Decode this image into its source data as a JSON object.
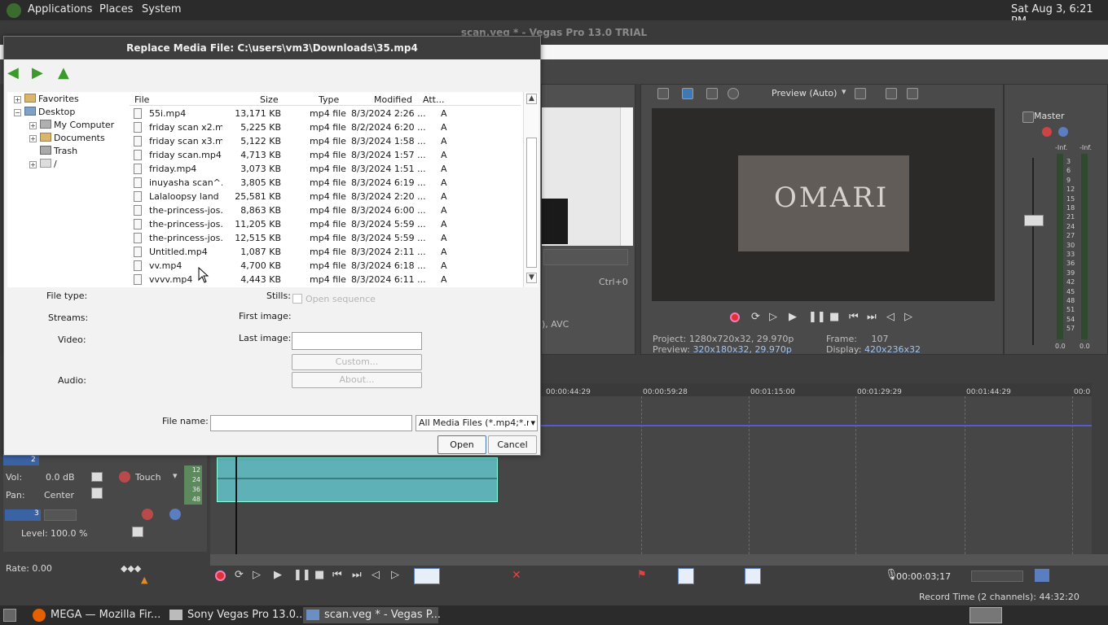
{
  "topbar": {
    "applications": "Applications",
    "places": "Places",
    "system": "System",
    "clock": "Sat Aug  3,  6:21 PM"
  },
  "vegas": {
    "window_title": "scan.veg * - Vegas Pro 13.0 TRIAL",
    "preview_mode": "Preview (Auto)",
    "shortcut": "Ctrl+0",
    "codec_partial": "), AVC",
    "project_label": "Project:",
    "project_value": "1280x720x32, 29.970p",
    "preview_label": "Preview:",
    "preview_value": "320x180x32, 29.970p",
    "frame_label": "Frame:",
    "frame_value": "107",
    "display_label": "Display:",
    "display_value": "420x236x32",
    "master_label": "Master",
    "meter_top": [
      "-Inf.",
      "-Inf."
    ],
    "meter_scale": [
      "3",
      "6",
      "9",
      "12",
      "15",
      "18",
      "21",
      "24",
      "27",
      "30",
      "33",
      "36",
      "39",
      "42",
      "45",
      "48",
      "51",
      "54",
      "57"
    ],
    "meter_bottom": [
      "0.0",
      "0.0"
    ],
    "ruler_ticks": [
      "00:00:44:29",
      "00:00:59:28",
      "00:01:15:00",
      "00:01:29:29",
      "00:01:44:29",
      "00:0"
    ],
    "track2": {
      "num": "2",
      "vol_label": "Vol:",
      "vol_value": "0.0 dB",
      "pan_label": "Pan:",
      "pan_value": "Center",
      "touch": "Touch",
      "db_marks": [
        "12",
        "24",
        "36",
        "48"
      ]
    },
    "track3": {
      "num": "3",
      "level_label": "Level:",
      "level_value": "100.0 %"
    },
    "rate_label": "Rate: 0.00",
    "timecode": "00:00:03;17",
    "record_time": "Record Time (2 channels): 44:32:20"
  },
  "dialog": {
    "title": "Replace Media File: C:\\users\\vm3\\Downloads\\35.mp4",
    "tree": [
      {
        "label": "Favorites",
        "expander": "+"
      },
      {
        "label": "Desktop",
        "expander": "−"
      },
      {
        "label": "My Computer",
        "expander": "+"
      },
      {
        "label": "Documents",
        "expander": "+"
      },
      {
        "label": "Trash",
        "expander": ""
      },
      {
        "label": "/",
        "expander": "+"
      }
    ],
    "columns": {
      "file": "File",
      "size": "Size",
      "type": "Type",
      "modified": "Modified",
      "attr": "Att..."
    },
    "files": [
      {
        "name": "55i.mp4",
        "size": "13,171 KB",
        "type": "mp4 file",
        "modified": "8/3/2024 2:26 ...",
        "attr": "A"
      },
      {
        "name": "friday scan x2.m...",
        "size": "5,225 KB",
        "type": "mp4 file",
        "modified": "8/2/2024 6:20 ...",
        "attr": "A"
      },
      {
        "name": "friday scan x3.m...",
        "size": "5,122 KB",
        "type": "mp4 file",
        "modified": "8/3/2024 1:58 ...",
        "attr": "A"
      },
      {
        "name": "friday scan.mp4",
        "size": "4,713 KB",
        "type": "mp4 file",
        "modified": "8/3/2024 1:57 ...",
        "attr": "A"
      },
      {
        "name": "friday.mp4",
        "size": "3,073 KB",
        "type": "mp4 file",
        "modified": "8/3/2024 1:51 ...",
        "attr": "A"
      },
      {
        "name": "inuyasha scan^...",
        "size": "3,805 KB",
        "type": "mp4 file",
        "modified": "8/3/2024 6:19 ...",
        "attr": "A"
      },
      {
        "name": "Lalaloopsy land ...",
        "size": "25,581 KB",
        "type": "mp4 file",
        "modified": "8/3/2024 2:20 ...",
        "attr": "A"
      },
      {
        "name": "the-princess-jos...",
        "size": "8,863 KB",
        "type": "mp4 file",
        "modified": "8/3/2024 6:00 ...",
        "attr": "A"
      },
      {
        "name": "the-princess-jos...",
        "size": "11,205 KB",
        "type": "mp4 file",
        "modified": "8/3/2024 5:59 ...",
        "attr": "A"
      },
      {
        "name": "the-princess-jos...",
        "size": "12,515 KB",
        "type": "mp4 file",
        "modified": "8/3/2024 5:59 ...",
        "attr": "A"
      },
      {
        "name": "Untitled.mp4",
        "size": "1,087 KB",
        "type": "mp4 file",
        "modified": "8/3/2024 2:11 ...",
        "attr": "A"
      },
      {
        "name": "vv.mp4",
        "size": "4,700 KB",
        "type": "mp4 file",
        "modified": "8/3/2024 6:18 ...",
        "attr": "A"
      },
      {
        "name": "vvvv.mp4",
        "size": "4,443 KB",
        "type": "mp4 file",
        "modified": "8/3/2024 6:11 ...",
        "attr": "A"
      }
    ],
    "file_type_label": "File type:",
    "streams_label": "Streams:",
    "video_label": "Video:",
    "audio_label": "Audio:",
    "stills_label": "Stills:",
    "open_sequence_label": "Open sequence",
    "first_image_label": "First image:",
    "last_image_label": "Last image:",
    "custom_label": "Custom...",
    "about_label": "About...",
    "file_name_label": "File name:",
    "file_name_value": "",
    "filter_value": "All Media Files (*.mp4;*.m",
    "open_label": "Open",
    "cancel_label": "Cancel"
  },
  "taskbar": {
    "items": [
      "MEGA — Mozilla Fir...",
      "Sony Vegas Pro 13.0...",
      "scan.veg * - Vegas P..."
    ]
  },
  "preview_image_text": "OMARI"
}
